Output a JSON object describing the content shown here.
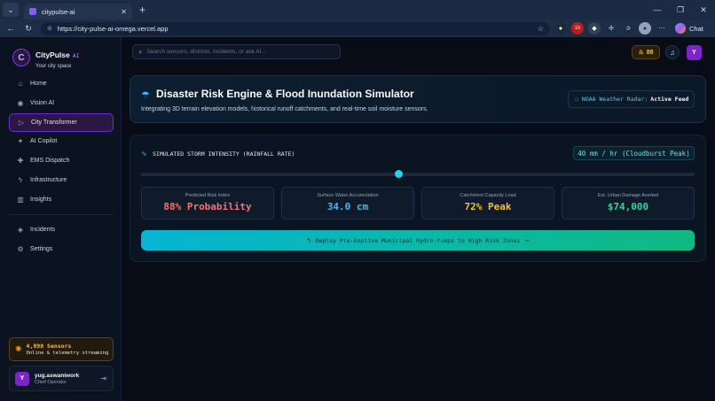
{
  "browser": {
    "tab_title": "citypulse-ai",
    "url": "https://city-pulse-ai-omega.vercel.app",
    "chat_label": "Chat",
    "ext_badge": "10"
  },
  "brand": {
    "name": "CityPulse",
    "ai": "AI",
    "tagline": "Your city space",
    "logo_letter": "C"
  },
  "search": {
    "placeholder": "Search sensors, districts, incidents, or ask AI..."
  },
  "topbar": {
    "points": "88",
    "avatar_letter": "Y"
  },
  "nav": {
    "items": [
      {
        "label": "Home",
        "icon": "home-icon",
        "glyph": "⌂"
      },
      {
        "label": "Vision AI",
        "icon": "eye-icon",
        "glyph": "◉"
      },
      {
        "label": "City Transformer",
        "icon": "play-icon",
        "glyph": "▷"
      },
      {
        "label": "AI Copilot",
        "icon": "sparkles-icon",
        "glyph": "✦"
      },
      {
        "label": "EMS Dispatch",
        "icon": "ambulance-icon",
        "glyph": "✚"
      },
      {
        "label": "Infrastructure",
        "icon": "bolt-icon",
        "glyph": "ϟ"
      },
      {
        "label": "Insights",
        "icon": "bar-chart-icon",
        "glyph": "▥"
      }
    ],
    "secondary": [
      {
        "label": "Incidents",
        "icon": "shield-icon",
        "glyph": "◈"
      },
      {
        "label": "Settings",
        "icon": "gear-icon",
        "glyph": "⚙"
      }
    ],
    "active_index": 2
  },
  "sensors": {
    "title": "4,890 Sensors",
    "subtitle": "Online & telemetry streaming"
  },
  "user": {
    "name": "yug.aswaniwork",
    "role": "Chief Operator",
    "avatar_letter": "Y"
  },
  "hero": {
    "title": "Disaster Risk Engine & Flood Inundation Simulator",
    "subtitle": "Integrating 3D terrain elevation models, historical runoff catchments, and real-time soil moisture sensors.",
    "radar_label": "NOAA Weather Radar:",
    "radar_status": "Active Feed"
  },
  "simulator": {
    "label": "SIMULATED STORM INTENSITY (RAINFALL RATE)",
    "rate": "40 mm / hr (Cloudburst Peak)",
    "slider_fraction": 0.466,
    "metrics": [
      {
        "label": "Predicted Risk Index",
        "value": "88% Probability",
        "color": "#f87171"
      },
      {
        "label": "Surface Water Accumulation",
        "value": "34.0 cm",
        "color": "#38bdf8"
      },
      {
        "label": "Catchment Capacity Load",
        "value": "72% Peak",
        "color": "#fbbf24"
      },
      {
        "label": "Est. Urban Damage Averted",
        "value": "$74,000",
        "color": "#34d399"
      }
    ],
    "deploy_label": "Deploy Pre-Emptive Municipal Hydro-Pumps to High Risk Zones"
  }
}
